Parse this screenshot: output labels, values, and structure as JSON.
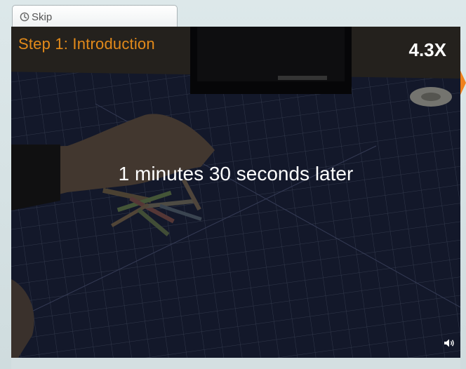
{
  "skip": {
    "label": "Skip",
    "icon": "clock-icon"
  },
  "video": {
    "step_title": "Step 1: Introduction",
    "speed": "4.3X",
    "caption": "1 minutes 30 seconds later",
    "volume_icon": "speaker-icon",
    "next_icon": "orange-arrow-right-icon"
  },
  "colors": {
    "step_title": "#e38a1a",
    "next_arrow": "#f0821e"
  }
}
